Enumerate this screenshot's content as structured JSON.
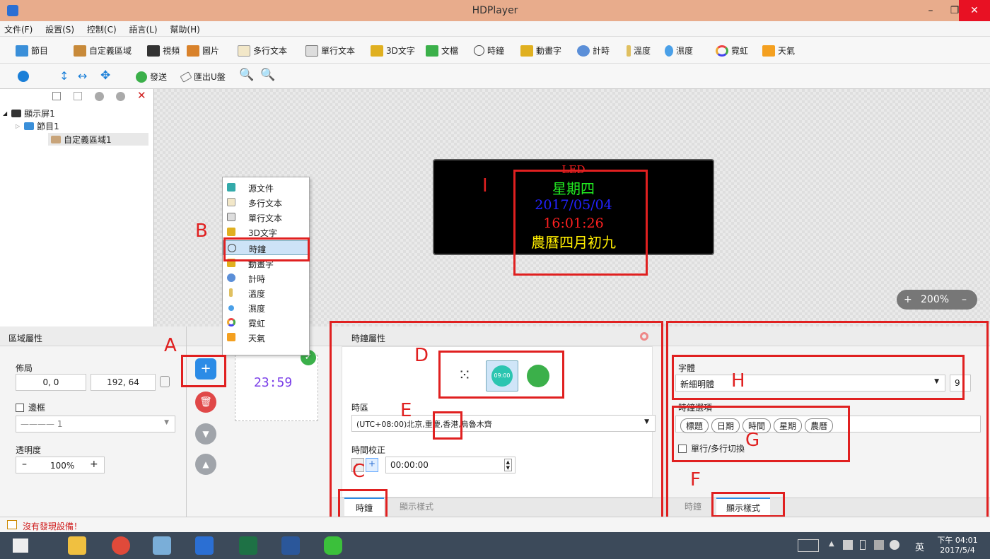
{
  "window": {
    "title": "HDPlayer",
    "min": "–",
    "max": "❐",
    "close": "✕"
  },
  "menu": [
    "文件(F)",
    "設置(S)",
    "控制(C)",
    "語言(L)",
    "幫助(H)"
  ],
  "toolbar1": {
    "program": "節目",
    "custom_area": "自定義區域",
    "video": "視頻",
    "image": "圖片",
    "multiline": "多行文本",
    "singleline": "單行文本",
    "text3d": "3D文字",
    "doc": "文檔",
    "clock": "時鐘",
    "anim": "動畫字",
    "timer": "計時",
    "temp": "溫度",
    "humidity": "濕度",
    "neon": "霓虹",
    "weather": "天氣"
  },
  "toolbar2": {
    "send": "發送",
    "export": "匯出U盤"
  },
  "tree": {
    "screen": "顯示屏1",
    "program": "節目1",
    "area": "自定義區域1"
  },
  "led": {
    "title": "LED",
    "weekday": "星期四",
    "date": "2017/05/04",
    "time": "16:01:26",
    "lunar": "農曆四月初九"
  },
  "zoom": {
    "plus": "+",
    "value": "200%",
    "minus": "–"
  },
  "context_menu": [
    "源文件",
    "多行文本",
    "單行文本",
    "3D文字",
    "時鐘",
    "動畫字",
    "計時",
    "溫度",
    "濕度",
    "霓虹",
    "天氣"
  ],
  "area_props": {
    "header": "區域屬性",
    "layout_label": "佈局",
    "pos": "0, 0",
    "size": "192, 64",
    "border_label": "邊框",
    "border_value": "1",
    "opacity_label": "透明度",
    "opacity_value": "100%",
    "minus": "–",
    "plus": "+"
  },
  "preview": {
    "time": "23:59"
  },
  "clock_props": {
    "header": "時鐘屬性",
    "tz_label": "時區",
    "tz_value": "(UTC+08:00)北京,重慶,香港,烏魯木齊",
    "correct_label": "時間校正",
    "correct_value": "00:00:00",
    "digital_face": "09:00",
    "tab_clock": "時鐘",
    "tab_style": "顯示樣式",
    "minus": "–",
    "plus": "+"
  },
  "style_props": {
    "font_label": "字體",
    "font_value": "新細明體",
    "font_size": "9",
    "options_label": "時鐘選項",
    "tags": [
      "標題",
      "日期",
      "時間",
      "星期",
      "農曆"
    ],
    "switch_label": "單行/多行切換",
    "tab_clock": "時鐘",
    "tab_style": "顯示樣式"
  },
  "annotations": {
    "A": "A",
    "B": "B",
    "C": "C",
    "D": "D",
    "E": "E",
    "F": "F",
    "G": "G",
    "H": "H",
    "I": "I"
  },
  "status": {
    "text": "沒有發現設備！"
  },
  "taskbar": {
    "time": "下午 04:01",
    "date": "2017/5/4",
    "ime": "英"
  },
  "colors": {
    "titlebar": "#e8ac8c",
    "accent": "#2b8be6",
    "annotation": "#e02020",
    "led_green": "#22ee22",
    "led_blue": "#2222ff",
    "led_red": "#ff2020",
    "led_yellow": "#ffee00"
  }
}
